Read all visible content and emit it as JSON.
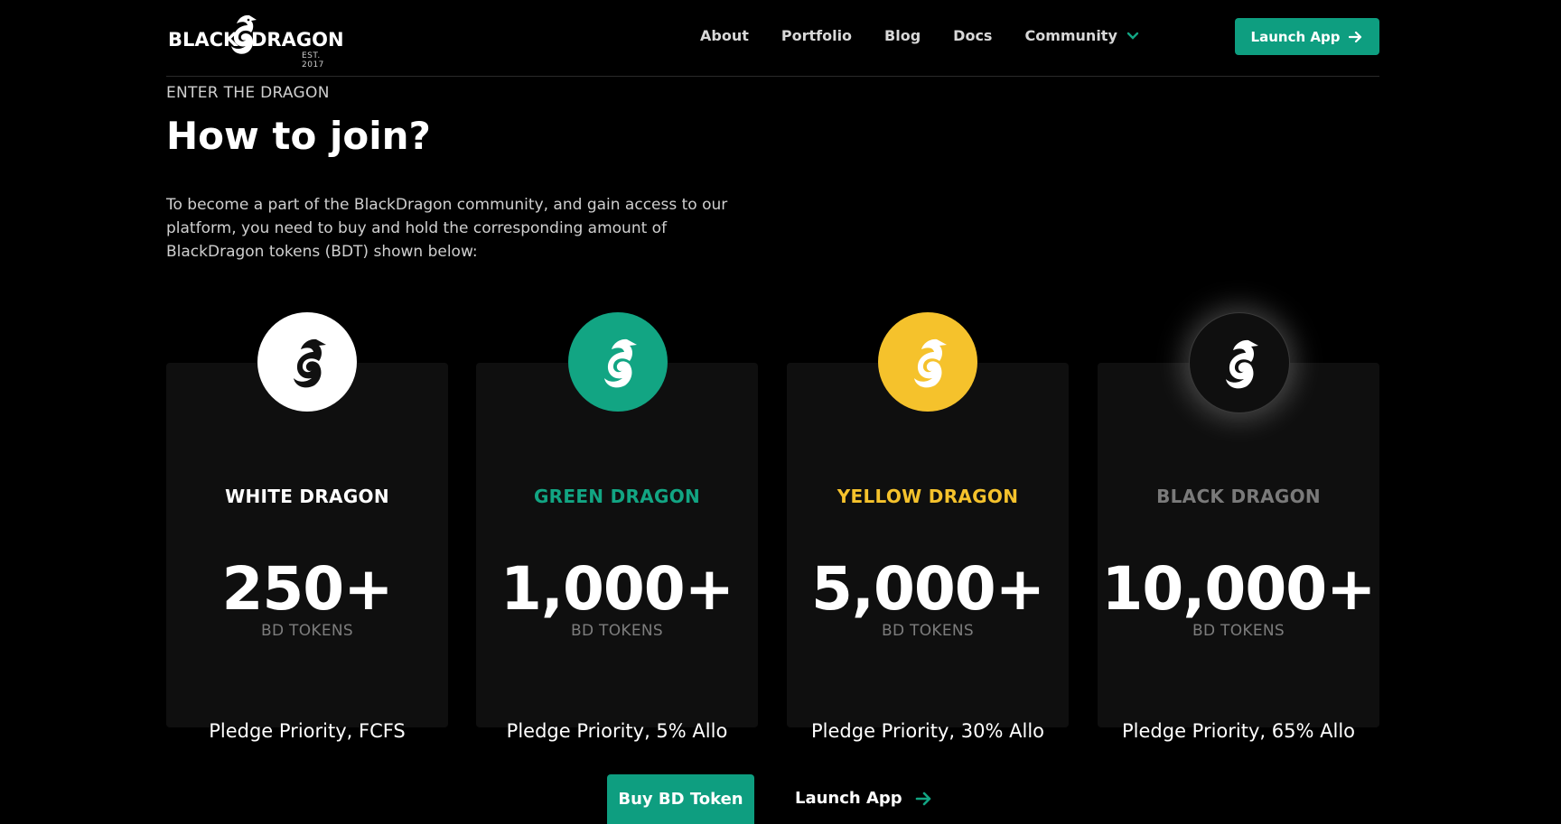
{
  "brand": {
    "word_left": "BLACK",
    "word_right": "DRAGON",
    "est": "EST. 2017"
  },
  "nav": {
    "links": [
      "About",
      "Portfolio",
      "Blog",
      "Docs",
      "Community"
    ],
    "launch_label": "Launch App"
  },
  "hero": {
    "eyebrow": "ENTER THE DRAGON",
    "title": "How to join?",
    "intro": "To become a part of the BlackDragon community, and gain access to our platform, you need to buy and hold the corresponding amount of BlackDragon tokens (BDT) shown below:"
  },
  "tiers": [
    {
      "name": "WHITE DRAGON",
      "amount": "250+",
      "unit": "BD TOKENS",
      "perk": "Pledge Priority, FCFS",
      "color": "#ffffff",
      "badge_bg": "#ffffff",
      "icon_color": "#111111"
    },
    {
      "name": "GREEN DRAGON",
      "amount": "1,000+",
      "unit": "BD TOKENS",
      "perk": "Pledge Priority, 5% Allo",
      "color": "#12a583",
      "badge_bg": "#12a583",
      "icon_color": "#ffffff"
    },
    {
      "name": "YELLOW DRAGON",
      "amount": "5,000+",
      "unit": "BD TOKENS",
      "perk": "Pledge Priority, 30% Allo",
      "color": "#f5c22c",
      "badge_bg": "#f5c22c",
      "icon_color": "#ffffff"
    },
    {
      "name": "BLACK DRAGON",
      "amount": "10,000+",
      "unit": "BD TOKENS",
      "perk": "Pledge Priority, 65% Allo",
      "color": "#7a7a7a",
      "badge_bg": "#0f0f0f",
      "icon_color": "#ffffff"
    }
  ],
  "cta": {
    "buy_label": "Buy BD Token",
    "launch_label": "Launch App"
  },
  "colors": {
    "accent": "#0e9e80",
    "background": "#000000"
  }
}
